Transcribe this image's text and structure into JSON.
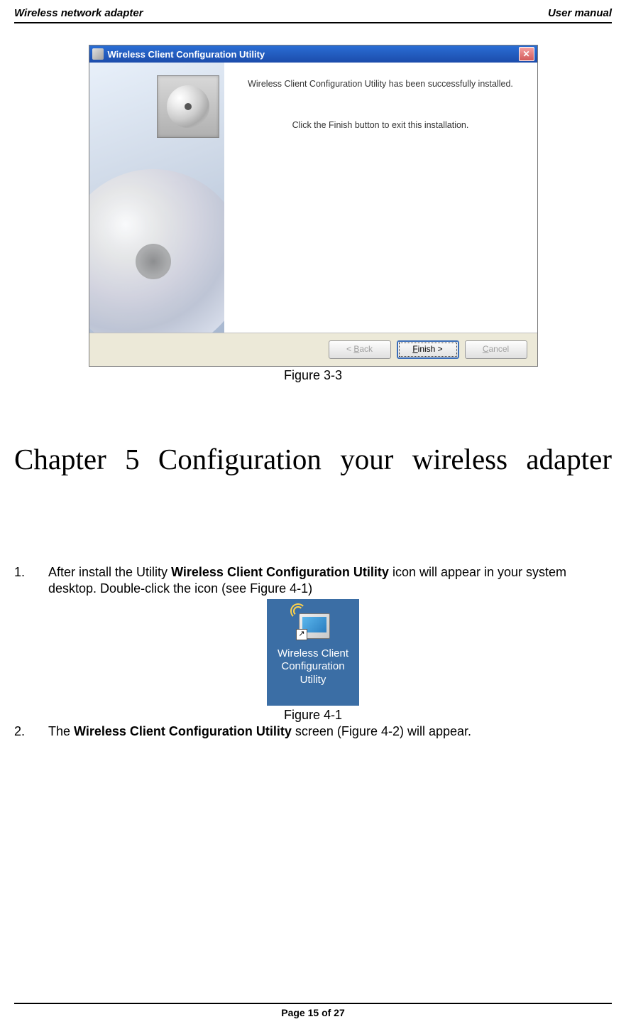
{
  "header": {
    "left": "Wireless network adapter",
    "right": "User manual"
  },
  "dialog": {
    "title": "Wireless Client Configuration Utility",
    "text1": "Wireless Client Configuration Utility has been successfully installed.",
    "text2": "Click the Finish button to exit this installation.",
    "buttons": {
      "back_prefix": "< ",
      "back_u": "B",
      "back_rest": "ack",
      "finish_u": "F",
      "finish_rest": "inish >",
      "cancel_u": "C",
      "cancel_rest": "ancel"
    }
  },
  "captions": {
    "fig33": "Figure 3-3",
    "fig41": "Figure 4-1"
  },
  "chapter_title": "Chapter 5 Configuration your wireless adapter",
  "list": {
    "item1_num": "1.",
    "item1_a": "After install the Utility ",
    "item1_b": "Wireless Client Configuration Utility",
    "item1_c": " icon will appear in your system desktop. Double-click the icon (see Figure 4-1)",
    "item2_num": "2.",
    "item2_a": "The ",
    "item2_b": "Wireless Client Configuration Utility",
    "item2_c": " screen (Figure 4-2) will appear."
  },
  "desktop_icon": {
    "label": "Wireless Client Configuration Utility",
    "shortcut_arrow": "↗"
  },
  "footer": "Page 15 of 27"
}
